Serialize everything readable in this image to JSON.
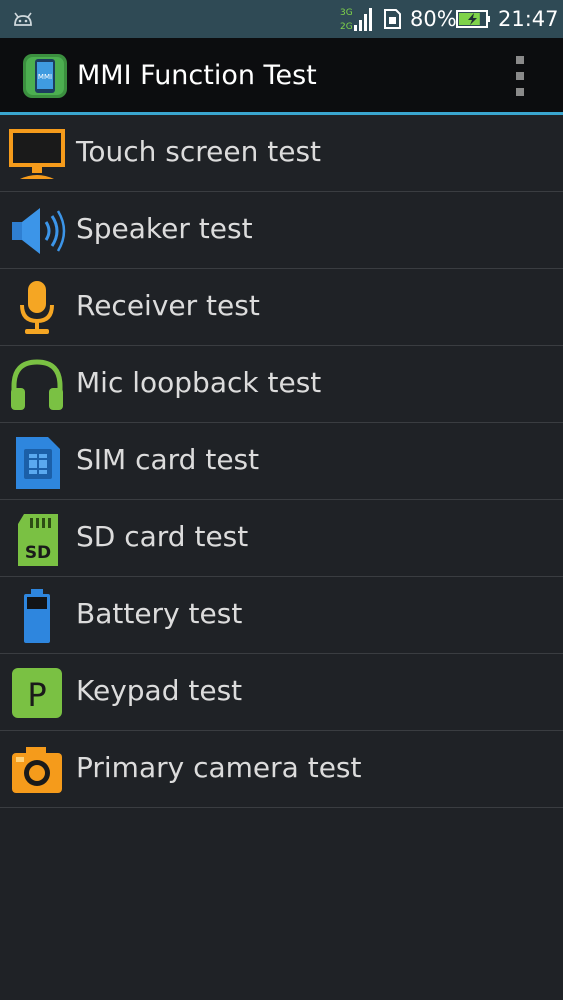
{
  "status_bar": {
    "network_top": "3G",
    "network_bottom": "2G",
    "battery_percent": "80%",
    "time": "21:47",
    "battery_level": 0.8,
    "colors": {
      "background": "#2f4a55",
      "battery_fill": "#7fd34a"
    }
  },
  "action_bar": {
    "app_icon_label": "MMI",
    "title": "MMI Function Test",
    "overflow_icon": "overflow-menu-icon",
    "accent": "#3aa6cf"
  },
  "tests": [
    {
      "label": "Touch screen test",
      "icon": "monitor-icon"
    },
    {
      "label": "Speaker test",
      "icon": "speaker-icon"
    },
    {
      "label": "Receiver test",
      "icon": "microphone-icon"
    },
    {
      "label": "Mic loopback test",
      "icon": "headphones-icon"
    },
    {
      "label": "SIM card test",
      "icon": "sim-card-icon"
    },
    {
      "label": "SD card test",
      "icon": "sd-card-icon"
    },
    {
      "label": "Battery test",
      "icon": "battery-icon"
    },
    {
      "label": "Keypad test",
      "icon": "keypad-p-icon"
    },
    {
      "label": "Primary camera test",
      "icon": "camera-icon"
    }
  ],
  "icon_glyphs": {
    "sd_card": "SD",
    "keypad": "P"
  }
}
